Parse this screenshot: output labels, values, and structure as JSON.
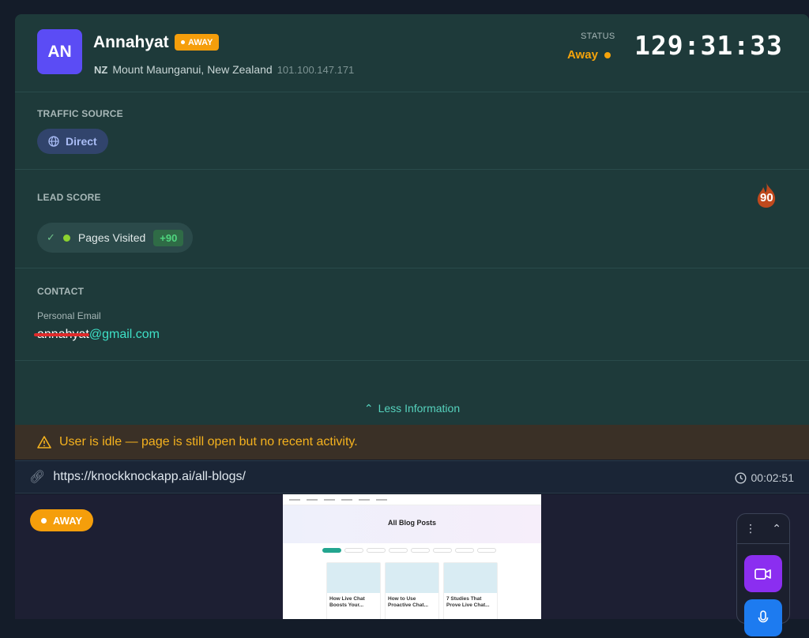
{
  "visitor": {
    "initials": "AN",
    "name": "Annahyat",
    "badge": "AWAY",
    "country_code": "NZ",
    "location": "Mount Maunganui, New Zealand",
    "ip": "101.100.147.171",
    "status_label": "STATUS",
    "status_value": "Away",
    "session_timer": "129:31:33"
  },
  "traffic": {
    "label": "TRAFFIC SOURCE",
    "source": "Direct"
  },
  "lead": {
    "label": "LEAD SCORE",
    "score": "90",
    "items": [
      {
        "label": "Pages Visited",
        "points": "+90"
      }
    ]
  },
  "contact": {
    "label": "CONTACT",
    "email_label": "Personal Email",
    "email_user": "annahyat",
    "email_domain": "@gmail.com"
  },
  "toggle": {
    "label": "Less Information"
  },
  "idle_warning": "User is idle — page is still open but no recent activity.",
  "page": {
    "url": "https://knockknockapp.ai/all-blogs/",
    "time_on_page": "00:02:51"
  },
  "viewer": {
    "badge": "AWAY",
    "preview": {
      "title": "All Blog Posts",
      "cards": [
        "How Live Chat Boosts Your...",
        "How to Use Proactive Chat...",
        "7 Studies That Prove Live Chat..."
      ]
    }
  },
  "colors": {
    "accent": "#5b4cf5",
    "away": "#f59e0b",
    "panel": "#1e3a3a",
    "link": "#56d2bd"
  }
}
